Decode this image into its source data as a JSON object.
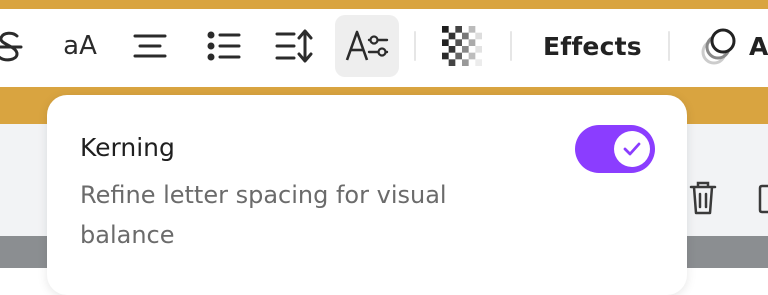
{
  "toolbar": {
    "font_size_label": "aA",
    "effects_label": "Effects",
    "animate_label_partial": "A"
  },
  "kerning": {
    "title": "Kerning",
    "description": "Refine letter spacing for visual balance",
    "enabled": true
  },
  "colors": {
    "accent": "#8b3dff",
    "gold_band": "#d9a440"
  }
}
